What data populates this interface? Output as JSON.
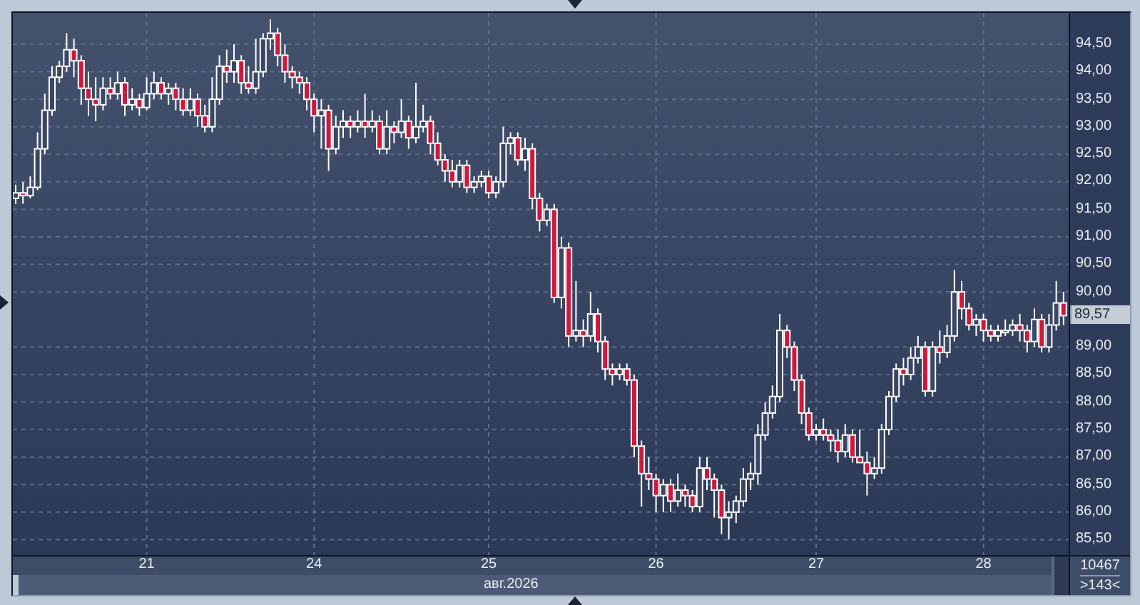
{
  "chart_data": {
    "type": "candlestick",
    "categories": [
      null,
      null,
      null,
      null,
      null,
      null,
      null,
      null,
      null,
      null,
      null,
      null,
      null,
      null,
      null,
      null,
      null,
      null,
      "21",
      null,
      null,
      null,
      null,
      null,
      null,
      null,
      null,
      null,
      null,
      null,
      null,
      null,
      null,
      null,
      null,
      null,
      null,
      null,
      null,
      null,
      null,
      "24",
      null,
      null,
      null,
      null,
      null,
      null,
      null,
      null,
      null,
      null,
      null,
      null,
      null,
      null,
      null,
      null,
      null,
      null,
      null,
      null,
      null,
      null,
      null,
      "25",
      null,
      null,
      null,
      null,
      null,
      null,
      null,
      null,
      null,
      null,
      null,
      null,
      null,
      null,
      null,
      null,
      null,
      null,
      null,
      null,
      null,
      null,
      "26",
      null,
      null,
      null,
      null,
      null,
      null,
      null,
      null,
      null,
      null,
      null,
      null,
      null,
      null,
      null,
      null,
      null,
      null,
      null,
      null,
      null,
      "27",
      null,
      null,
      null,
      null,
      null,
      null,
      null,
      null,
      null,
      null,
      null,
      null,
      null,
      null,
      null,
      null,
      null,
      null,
      null,
      null,
      null,
      null,
      "28",
      null,
      null,
      null,
      null,
      null,
      null,
      null,
      null,
      null,
      null,
      null
    ],
    "ylim": [
      85.22,
      95.07
    ],
    "grid": true,
    "yticks": [
      {
        "value": 94.5,
        "label": "94,50"
      },
      {
        "value": 94,
        "label": "94,00"
      },
      {
        "value": 93.5,
        "label": "93,50"
      },
      {
        "value": 93,
        "label": "93,00"
      },
      {
        "value": 92.5,
        "label": "92,50"
      },
      {
        "value": 92,
        "label": "92,00"
      },
      {
        "value": 91.5,
        "label": "91,50"
      },
      {
        "value": 91,
        "label": "91,00"
      },
      {
        "value": 90.5,
        "label": "90,50"
      },
      {
        "value": 90,
        "label": "90,00"
      },
      {
        "value": 89,
        "label": "89,00"
      },
      {
        "value": 88.5,
        "label": "88,50"
      },
      {
        "value": 88,
        "label": "88,00"
      },
      {
        "value": 87.5,
        "label": "87,50"
      },
      {
        "value": 87,
        "label": "87,00"
      },
      {
        "value": 86.5,
        "label": "86,50"
      },
      {
        "value": 86,
        "label": "86,00"
      },
      {
        "value": 85.5,
        "label": "85,50"
      }
    ],
    "ohlc": [
      [
        91.7,
        91.95,
        91.6,
        91.8
      ],
      [
        91.8,
        92.0,
        91.6,
        91.75
      ],
      [
        91.75,
        92.1,
        91.7,
        91.9
      ],
      [
        91.9,
        92.9,
        91.85,
        92.6
      ],
      [
        92.6,
        93.6,
        92.5,
        93.3
      ],
      [
        93.3,
        94.1,
        93.2,
        93.9
      ],
      [
        93.9,
        94.2,
        93.8,
        94.1
      ],
      [
        94.1,
        94.7,
        94.0,
        94.4
      ],
      [
        94.4,
        94.6,
        93.9,
        94.2
      ],
      [
        94.2,
        94.3,
        93.4,
        93.7
      ],
      [
        93.7,
        94.0,
        93.2,
        93.5
      ],
      [
        93.5,
        93.9,
        93.1,
        93.4
      ],
      [
        93.4,
        93.9,
        93.3,
        93.7
      ],
      [
        93.7,
        93.9,
        93.5,
        93.6
      ],
      [
        93.6,
        94.0,
        93.5,
        93.8
      ],
      [
        93.8,
        93.9,
        93.2,
        93.4
      ],
      [
        93.4,
        93.7,
        93.3,
        93.5
      ],
      [
        93.5,
        93.6,
        93.2,
        93.35
      ],
      [
        93.35,
        93.9,
        93.3,
        93.6
      ],
      [
        93.6,
        94.0,
        93.5,
        93.8
      ],
      [
        93.8,
        93.9,
        93.5,
        93.6
      ],
      [
        93.6,
        93.8,
        93.4,
        93.7
      ],
      [
        93.7,
        93.8,
        93.3,
        93.5
      ],
      [
        93.5,
        93.7,
        93.2,
        93.3
      ],
      [
        93.3,
        93.7,
        93.2,
        93.5
      ],
      [
        93.5,
        93.6,
        93.0,
        93.2
      ],
      [
        93.2,
        93.4,
        92.9,
        93.0
      ],
      [
        93.0,
        93.9,
        92.9,
        93.5
      ],
      [
        93.5,
        94.3,
        93.4,
        94.1
      ],
      [
        94.1,
        94.4,
        93.8,
        94.0
      ],
      [
        94.0,
        94.5,
        93.8,
        94.2
      ],
      [
        94.2,
        94.3,
        93.6,
        93.8
      ],
      [
        93.8,
        94.1,
        93.6,
        93.7
      ],
      [
        93.7,
        94.6,
        93.6,
        94.0
      ],
      [
        94.0,
        94.7,
        93.9,
        94.6
      ],
      [
        94.6,
        94.95,
        94.4,
        94.7
      ],
      [
        94.7,
        94.8,
        94.1,
        94.3
      ],
      [
        94.3,
        94.5,
        93.8,
        94.0
      ],
      [
        94.0,
        94.1,
        93.7,
        93.9
      ],
      [
        93.9,
        94.0,
        93.6,
        93.8
      ],
      [
        93.8,
        93.9,
        93.3,
        93.5
      ],
      [
        93.5,
        93.6,
        92.9,
        93.2
      ],
      [
        93.2,
        93.5,
        92.6,
        93.3
      ],
      [
        93.3,
        93.4,
        92.2,
        92.6
      ],
      [
        92.6,
        93.2,
        92.5,
        93.0
      ],
      [
        93.0,
        93.3,
        92.8,
        93.1
      ],
      [
        93.1,
        93.2,
        92.8,
        93.0
      ],
      [
        93.0,
        93.3,
        92.9,
        93.1
      ],
      [
        93.1,
        93.6,
        92.8,
        93.0
      ],
      [
        93.0,
        93.3,
        92.9,
        93.1
      ],
      [
        93.1,
        93.2,
        92.5,
        92.6
      ],
      [
        92.6,
        93.3,
        92.5,
        93.0
      ],
      [
        93.0,
        93.1,
        92.7,
        92.9
      ],
      [
        92.9,
        93.5,
        92.8,
        93.1
      ],
      [
        93.1,
        93.2,
        92.6,
        92.8
      ],
      [
        92.8,
        93.8,
        92.7,
        93.0
      ],
      [
        93.0,
        93.4,
        92.9,
        93.1
      ],
      [
        93.1,
        93.2,
        92.5,
        92.7
      ],
      [
        92.7,
        92.9,
        92.3,
        92.4
      ],
      [
        92.4,
        92.5,
        92.0,
        92.2
      ],
      [
        92.2,
        92.4,
        91.9,
        92.0
      ],
      [
        92.0,
        92.4,
        91.9,
        92.3
      ],
      [
        92.3,
        92.4,
        91.8,
        91.9
      ],
      [
        91.9,
        92.1,
        91.8,
        92.0
      ],
      [
        92.0,
        92.2,
        91.9,
        92.1
      ],
      [
        92.1,
        92.2,
        91.7,
        91.8
      ],
      [
        91.8,
        92.1,
        91.7,
        92.0
      ],
      [
        92.0,
        93.0,
        91.9,
        92.7
      ],
      [
        92.7,
        92.9,
        92.5,
        92.8
      ],
      [
        92.8,
        92.9,
        92.3,
        92.4
      ],
      [
        92.4,
        92.8,
        92.2,
        92.6
      ],
      [
        92.6,
        92.7,
        91.5,
        91.7
      ],
      [
        91.7,
        91.8,
        91.1,
        91.3
      ],
      [
        91.3,
        91.6,
        91.2,
        91.5
      ],
      [
        91.5,
        91.6,
        89.8,
        89.9
      ],
      [
        89.9,
        91.0,
        89.7,
        90.8
      ],
      [
        90.8,
        90.9,
        89.0,
        89.2
      ],
      [
        89.2,
        90.2,
        89.1,
        89.3
      ],
      [
        89.3,
        89.5,
        89.0,
        89.2
      ],
      [
        89.2,
        90.0,
        89.1,
        89.6
      ],
      [
        89.6,
        89.7,
        88.9,
        89.1
      ],
      [
        89.1,
        89.2,
        88.4,
        88.6
      ],
      [
        88.6,
        88.7,
        88.3,
        88.5
      ],
      [
        88.5,
        88.7,
        88.4,
        88.6
      ],
      [
        88.6,
        88.7,
        88.3,
        88.4
      ],
      [
        88.4,
        88.5,
        87.0,
        87.2
      ],
      [
        87.2,
        87.3,
        86.1,
        86.7
      ],
      [
        86.7,
        87.0,
        86.4,
        86.6
      ],
      [
        86.6,
        86.7,
        86.0,
        86.3
      ],
      [
        86.3,
        86.6,
        86.0,
        86.5
      ],
      [
        86.5,
        86.6,
        86.0,
        86.2
      ],
      [
        86.2,
        86.7,
        86.1,
        86.4
      ],
      [
        86.4,
        86.5,
        86.1,
        86.3
      ],
      [
        86.3,
        86.4,
        86.0,
        86.1
      ],
      [
        86.1,
        87.0,
        86.0,
        86.8
      ],
      [
        86.8,
        87.0,
        86.4,
        86.6
      ],
      [
        86.6,
        86.7,
        85.9,
        86.4
      ],
      [
        86.4,
        86.5,
        85.6,
        85.9
      ],
      [
        85.9,
        86.2,
        85.5,
        86.0
      ],
      [
        86.0,
        86.3,
        85.8,
        86.2
      ],
      [
        86.2,
        86.8,
        86.1,
        86.6
      ],
      [
        86.6,
        86.9,
        86.4,
        86.7
      ],
      [
        86.7,
        87.6,
        86.5,
        87.4
      ],
      [
        87.4,
        88.0,
        87.3,
        87.8
      ],
      [
        87.8,
        88.3,
        87.7,
        88.1
      ],
      [
        88.1,
        89.6,
        88.0,
        89.3
      ],
      [
        89.3,
        89.4,
        88.8,
        89.0
      ],
      [
        89.0,
        89.1,
        88.2,
        88.4
      ],
      [
        88.4,
        88.5,
        87.6,
        87.8
      ],
      [
        87.8,
        87.9,
        87.3,
        87.4
      ],
      [
        87.4,
        87.6,
        87.3,
        87.5
      ],
      [
        87.5,
        87.7,
        87.3,
        87.4
      ],
      [
        87.4,
        87.5,
        87.1,
        87.3
      ],
      [
        87.3,
        87.5,
        86.9,
        87.1
      ],
      [
        87.1,
        87.6,
        87.0,
        87.4
      ],
      [
        87.4,
        87.5,
        86.9,
        87.0
      ],
      [
        87.0,
        87.5,
        86.9,
        86.9
      ],
      [
        86.9,
        87.1,
        86.3,
        86.7
      ],
      [
        86.7,
        87.0,
        86.6,
        86.8
      ],
      [
        86.8,
        87.6,
        86.7,
        87.5
      ],
      [
        87.5,
        88.2,
        87.4,
        88.1
      ],
      [
        88.1,
        88.7,
        88.0,
        88.6
      ],
      [
        88.6,
        88.8,
        88.3,
        88.5
      ],
      [
        88.5,
        89.0,
        88.4,
        88.8
      ],
      [
        88.8,
        89.2,
        88.7,
        89.0
      ],
      [
        89.0,
        89.1,
        88.1,
        88.2
      ],
      [
        88.2,
        89.1,
        88.1,
        89.0
      ],
      [
        89.0,
        89.3,
        88.7,
        88.9
      ],
      [
        88.9,
        89.4,
        88.8,
        89.2
      ],
      [
        89.2,
        90.4,
        89.1,
        90.0
      ],
      [
        90.0,
        90.2,
        89.5,
        89.7
      ],
      [
        89.7,
        89.8,
        89.3,
        89.4
      ],
      [
        89.4,
        89.6,
        89.2,
        89.5
      ],
      [
        89.5,
        89.6,
        89.1,
        89.3
      ],
      [
        89.3,
        89.4,
        89.1,
        89.2
      ],
      [
        89.2,
        89.4,
        89.1,
        89.3
      ],
      [
        89.3,
        89.5,
        89.2,
        89.3
      ],
      [
        89.3,
        89.5,
        89.2,
        89.4
      ],
      [
        89.4,
        89.6,
        89.1,
        89.3
      ],
      [
        89.3,
        89.4,
        88.9,
        89.1
      ],
      [
        89.1,
        89.7,
        89.0,
        89.5
      ],
      [
        89.5,
        89.6,
        88.9,
        89.0
      ],
      [
        89.0,
        89.6,
        88.9,
        89.4
      ],
      [
        89.4,
        90.2,
        89.3,
        89.8
      ],
      [
        89.8,
        90.0,
        89.4,
        89.57
      ]
    ]
  },
  "current_price": "89,57",
  "month_label": "авг.2026",
  "footer": {
    "count": "10467",
    "range": ">143<"
  }
}
